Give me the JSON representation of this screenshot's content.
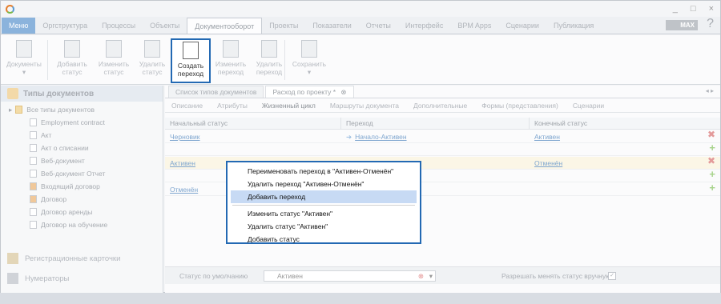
{
  "window": {
    "controls": [
      "_",
      "□",
      "×"
    ],
    "max_label": "MAX",
    "help": "?"
  },
  "menu": {
    "items": [
      {
        "label": "Меню"
      },
      {
        "label": "Оргструктура"
      },
      {
        "label": "Процессы"
      },
      {
        "label": "Объекты"
      },
      {
        "label": "Документооборот"
      },
      {
        "label": "Проекты"
      },
      {
        "label": "Показатели"
      },
      {
        "label": "Отчеты"
      },
      {
        "label": "Интерфейс"
      },
      {
        "label": "BPM Apps"
      },
      {
        "label": "Сценарии"
      },
      {
        "label": "Публикация"
      }
    ]
  },
  "ribbon": {
    "buttons": [
      {
        "l1": "Документы",
        "l2": "▾"
      },
      {
        "l1": "Добавить",
        "l2": "статус"
      },
      {
        "l1": "Изменить",
        "l2": "статус"
      },
      {
        "l1": "Удалить",
        "l2": "статус"
      },
      {
        "l1": "Создать",
        "l2": "переход"
      },
      {
        "l1": "Изменить",
        "l2": "переход"
      },
      {
        "l1": "Удалить",
        "l2": "переход"
      },
      {
        "l1": "Сохранить",
        "l2": "▾"
      }
    ]
  },
  "left_panel": {
    "header": "Типы документов",
    "root": "Все типы документов",
    "items": [
      "Employment contract",
      "Акт",
      "Акт о списании",
      "Веб-документ",
      "Веб-документ Отчет",
      "Входящий договор",
      "Договор",
      "Договор аренды",
      "Договор на обучение"
    ],
    "section1": "Регистрационные карточки",
    "section2": "Нумераторы"
  },
  "doc_tabs": [
    "Список типов документов",
    "Расход по проекту *"
  ],
  "sub_tabs": [
    "Описание",
    "Атрибуты",
    "Жизненный цикл",
    "Маршруты документа",
    "Дополнительные",
    "Формы (представления)",
    "Сценарии"
  ],
  "grid": {
    "headers": [
      "Начальный статус",
      "Переход",
      "Конечный статус"
    ],
    "rows": [
      {
        "start": "Черновик",
        "transition": "Начало-Активен",
        "end": "Активен"
      },
      {
        "start": "Активен",
        "transition": "",
        "end": "Отменён"
      },
      {
        "start": "Отменён",
        "transition": "",
        "end": ""
      }
    ]
  },
  "context_menu": {
    "items": [
      "Переименовать переход в \"Активен-Отменён\"",
      "Удалить переход \"Активен-Отменён\"",
      "Добавить переход",
      "Изменить статус \"Активен\"",
      "Удалить статус \"Активен\"",
      "Добавить статус"
    ]
  },
  "footer": {
    "default_status_label": "Статус по умолчанию",
    "default_status_value": "Активен",
    "allow_change_label": "Разрешать менять статус вручную"
  }
}
